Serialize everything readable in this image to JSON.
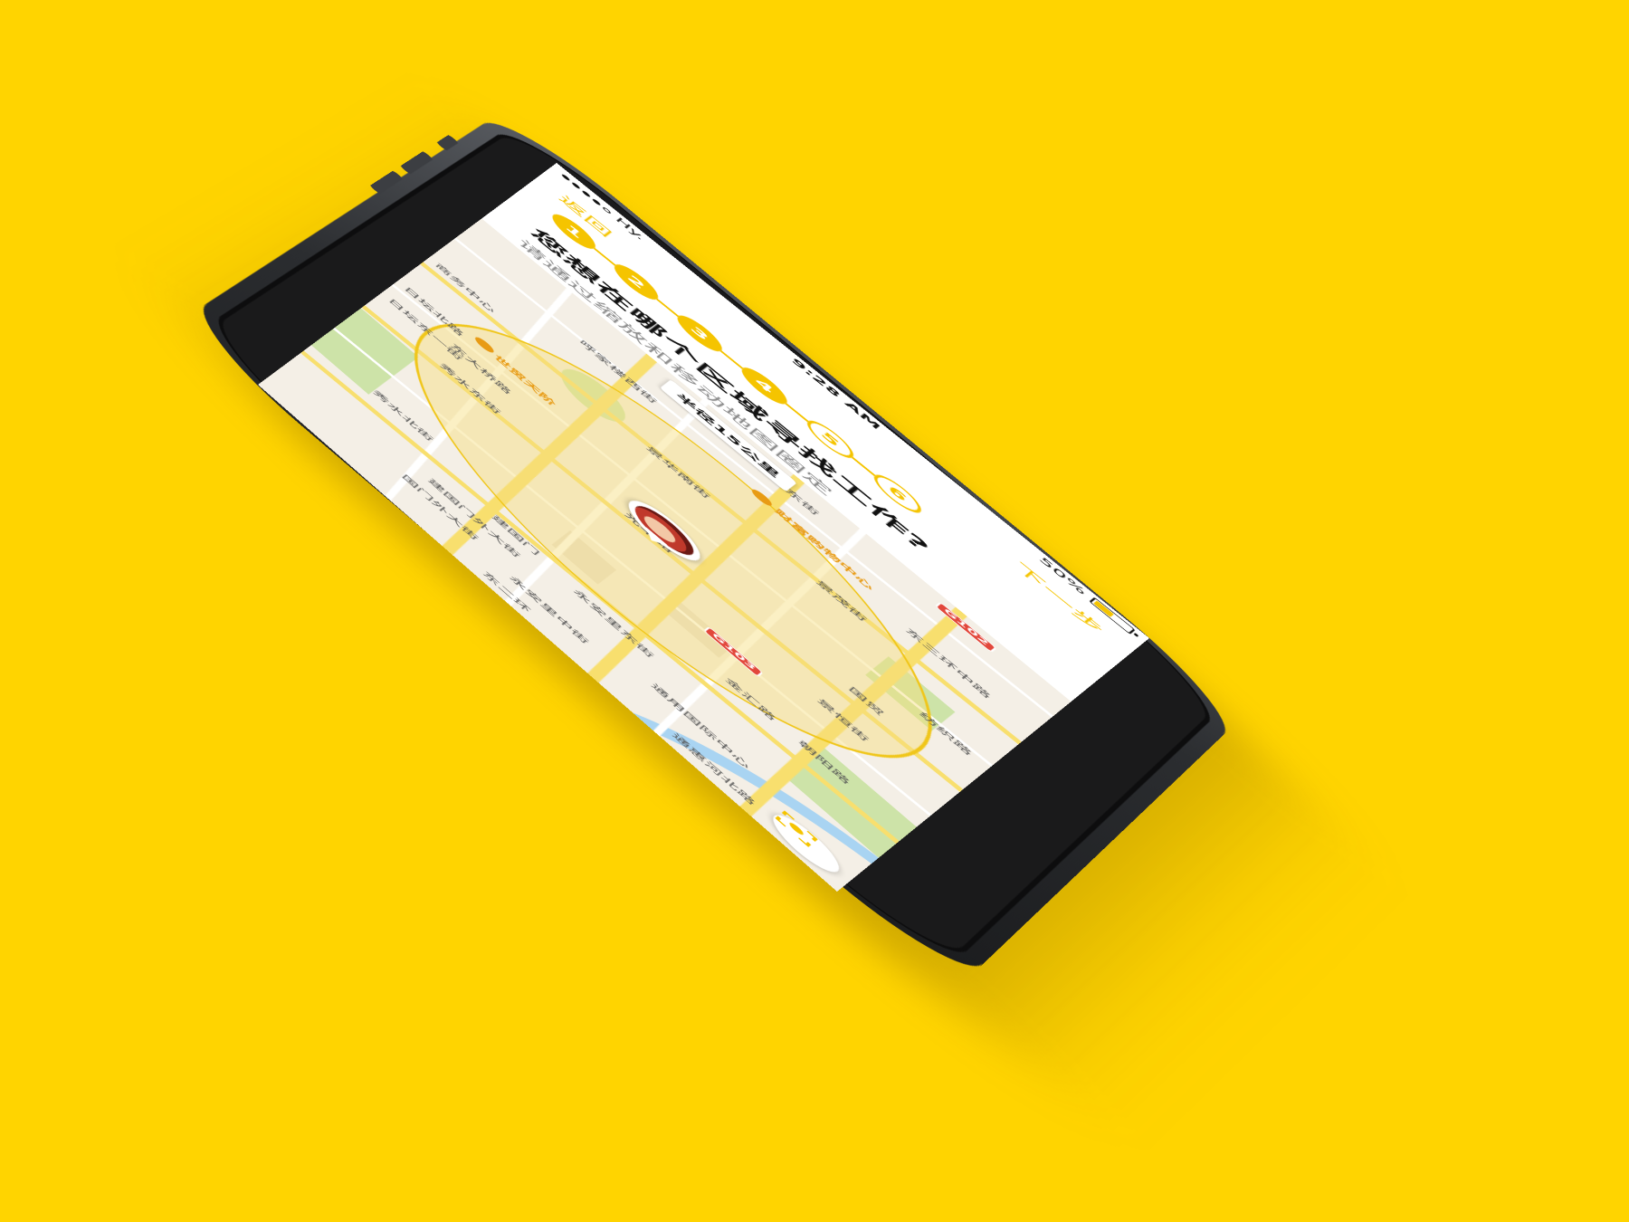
{
  "status_bar": {
    "carrier": "Hy.",
    "time": "9:28 AM",
    "battery_percent": "50%",
    "battery_level": 0.5
  },
  "nav": {
    "back_label": "返回",
    "next_label": "下一步"
  },
  "steps": [
    {
      "label": "1",
      "state": "done"
    },
    {
      "label": "2",
      "state": "done"
    },
    {
      "label": "3",
      "state": "done"
    },
    {
      "label": "4",
      "state": "done"
    },
    {
      "label": "5",
      "state": "todo"
    },
    {
      "label": "6",
      "state": "todo"
    }
  ],
  "question": "您想在哪个区域寻找工作?",
  "hint": "请通过缩放和移动地图圈定",
  "map": {
    "radius_label": "半径15公里",
    "highways": [
      "G102",
      "G103"
    ],
    "pois": [
      "财富购物中心",
      "世贸天阶"
    ],
    "street_labels": [
      "光华路",
      "景华南街",
      "景茂街",
      "东三环中路",
      "日坛北路",
      "日坛东一街",
      "秀水东街",
      "秀水北街",
      "东大桥路",
      "建国门外大街",
      "永安里东街",
      "永安里中街",
      "通惠河北路",
      "景恒街",
      "金汇路",
      "朝阳路",
      "呼家楼西街",
      "光华东街",
      "国贸",
      "建国门",
      "国门外大街",
      "通用国际中心",
      "纺织路",
      "东二环",
      "商务中心"
    ]
  },
  "colors": {
    "accent": "#F5C400",
    "background": "#FFD400",
    "circle_fill": "#F7DE7C",
    "circle_stroke": "#F0C61A"
  },
  "icons": {
    "locate": "crosshair-icon"
  }
}
